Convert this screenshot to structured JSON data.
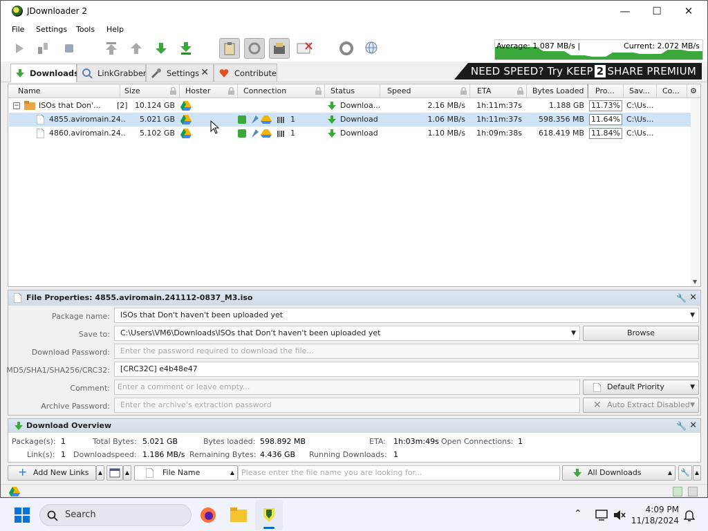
{
  "window": {
    "title": "JDownloader 2"
  },
  "menu": [
    "File",
    "Settings",
    "Tools",
    "Help"
  ],
  "speed": {
    "average": "Average: 1.087 MB/s |",
    "current": "Current: 2.072 MB/s"
  },
  "tabs": [
    {
      "label": "Downloads",
      "active": true
    },
    {
      "label": "LinkGrabber"
    },
    {
      "label": "Settings"
    },
    {
      "label": "Contribute"
    }
  ],
  "banner": {
    "pre": "NEED SPEED? Try KEEP",
    "two": "2",
    "post": "SHARE PREMIUM"
  },
  "columns": [
    "Name",
    "Size",
    "Hoster",
    "Connection",
    "Status",
    "Speed",
    "ETA",
    "Bytes Loaded",
    "Pro...",
    "Sav...",
    "Co..."
  ],
  "rows": [
    {
      "expander": "−",
      "name": "ISOs that Don'...",
      "count": "[2]",
      "size": "10.124 GB",
      "status": "Downloa...",
      "speed": "2.16 MB/s",
      "eta": "1h:11m:37s",
      "loaded": "1.188 GB",
      "progress": "11.73%",
      "save": "C:\\Us...",
      "conn_count": ""
    },
    {
      "name": "4855.aviromain.24...",
      "size": "5.021 GB",
      "status": "Download",
      "speed": "1.06 MB/s",
      "eta": "1h:11m:37s",
      "loaded": "598.356 MB",
      "progress": "11.64%",
      "save": "C:\\Us...",
      "conn_count": "1"
    },
    {
      "name": "4860.aviromain.24...",
      "size": "5.102 GB",
      "status": "Download",
      "speed": "1.10 MB/s",
      "eta": "1h:09m:38s",
      "loaded": "618.419 MB",
      "progress": "11.84%",
      "save": "C:\\Us...",
      "conn_count": "1"
    }
  ],
  "props": {
    "header": "File Properties: 4855.aviromain.241112-0837_M3.iso",
    "labels": {
      "package": "Package name:",
      "save": "Save to:",
      "password": "Download Password:",
      "hash": "MD5/SHA1/SHA256/CRC32:",
      "comment": "Comment:",
      "archive": "Archive Password:"
    },
    "package_name": "ISOs that Don't haven't been uploaded yet",
    "save_to": "C:\\Users\\VM6\\Downloads\\ISOs that Don't haven't been uploaded yet",
    "browse": "Browse",
    "password_placeholder": "Enter the password required to download the file...",
    "hash": "[CRC32C] e4b48e47",
    "comment_placeholder": "Enter a comment or leave empty...",
    "priority": "Default Priority",
    "archive_placeholder": "Enter the archive's extraction password",
    "extract": "Auto Extract Disabled"
  },
  "overview": {
    "header": "Download Overview",
    "packages_label": "Package(s):",
    "packages": "1",
    "total_label": "Total Bytes:",
    "total": "5.021 GB",
    "loaded_label": "Bytes loaded:",
    "loaded": "598.892 MB",
    "eta_label": "ETA:",
    "eta": "1h:03m:49s",
    "open_label": "Open Connections:",
    "open": "1",
    "links_label": "Link(s):",
    "links": "1",
    "dlspeed_label": "Downloadspeed:",
    "dlspeed": "1.186 MB/s",
    "remaining_label": "Remaining Bytes:",
    "remaining": "4.436 GB",
    "running_label": "Running Downloads:",
    "running": "1"
  },
  "bottom": {
    "add_links": "Add New Links",
    "file_name": "File Name",
    "search_placeholder": "Please enter the file name you are looking for...",
    "filter": "All Downloads"
  },
  "taskbar": {
    "search": "Search",
    "time": "4:09 PM",
    "date": "11/18/2024"
  },
  "colors": {
    "green": "#3aa83a",
    "accent": "#0067c0",
    "selected": "#cfe3f7"
  }
}
